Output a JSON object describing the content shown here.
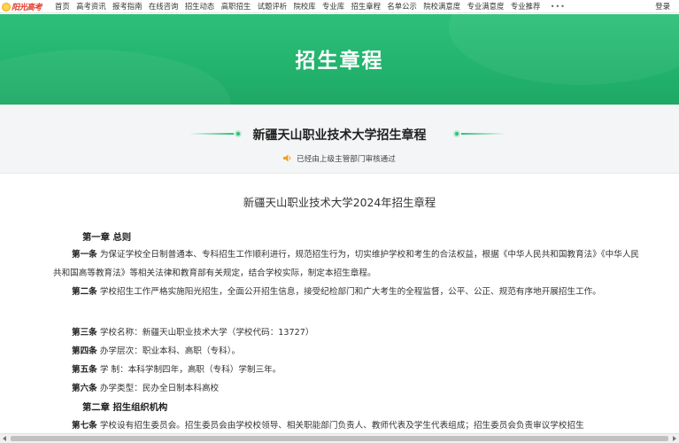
{
  "logo": {
    "text": "阳光高考"
  },
  "nav": {
    "items": [
      "首页",
      "高考资讯",
      "报考指南",
      "在线咨询",
      "招生动态",
      "高职招生",
      "试题评析",
      "院校库",
      "专业库",
      "招生章程",
      "名单公示",
      "院校满意度",
      "专业满意度",
      "专业推荐"
    ],
    "more": "•••",
    "login": "登录"
  },
  "banner": {
    "title": "招生章程"
  },
  "subhead": {
    "title": "新疆天山职业技术大学招生章程",
    "notice": "已经由上级主管部门审核通过",
    "icon": "speaker-icon"
  },
  "doc": {
    "title": "新疆天山职业技术大学2024年招生章程",
    "chapter1": "第一章 总则",
    "art1_label": "第一条",
    "art1_text": " 为保证学校全日制普通本、专科招生工作顺利进行，规范招生行为，切实维护学校和考生的合法权益，根据《中华人民共和国教育法》《中华人民共和国高等教育法》等相关法律和教育部有关规定，结合学校实际，制定本招生章程。",
    "art2_label": "第二条",
    "art2_text": " 学校招生工作严格实施阳光招生，全面公开招生信息，接受纪检部门和广大考生的全程监督，公平、公正、规范有序地开展招生工作。",
    "art3_label": "第三条",
    "art3_text": " 学校名称：新疆天山职业技术大学（学校代码：13727）",
    "art4_label": "第四条",
    "art4_text": " 办学层次：职业本科、高职（专科）。",
    "art5_label": "第五条",
    "art5_text": " 学 制：本科学制四年，高职（专科）学制三年。",
    "art6_label": "第六条",
    "art6_text": " 办学类型：民办全日制本科高校",
    "chapter2": "第二章 招生组织机构",
    "art7_label": "第七条",
    "art7_text": " 学校设有招生委员会。招生委员会由学校校领导、相关职能部门负责人、教师代表及学生代表组成；招生委员会负责审议学校招生"
  },
  "colors": {
    "accent": "#2ec07a",
    "banner": "#22b36d"
  }
}
